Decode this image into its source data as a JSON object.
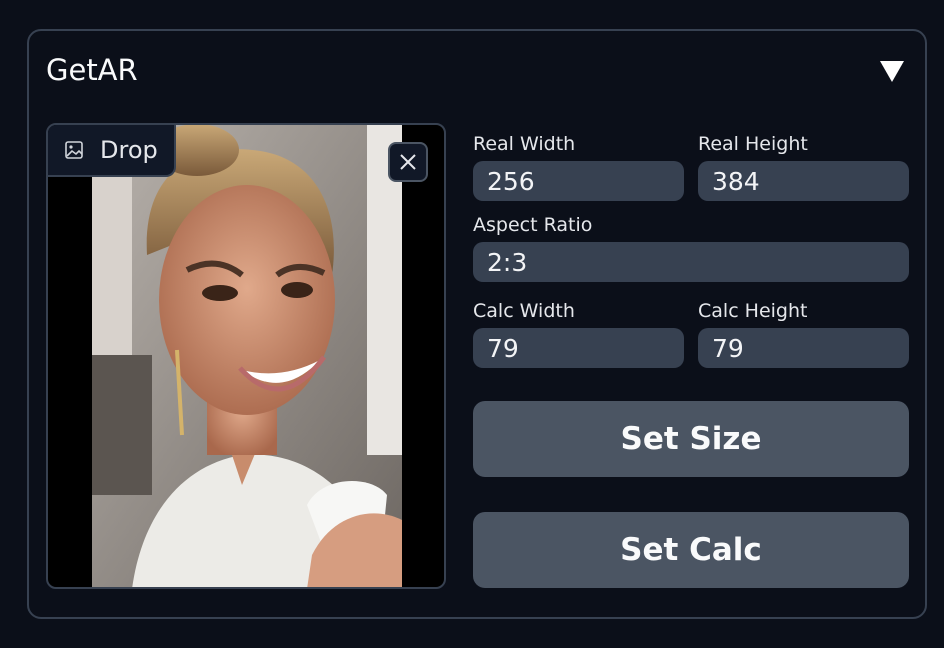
{
  "panel": {
    "title": "GetAR",
    "toggle_icon": "triangle-down-icon"
  },
  "image": {
    "drop_label": "Drop",
    "drop_icon": "image-icon",
    "close_icon": "close-icon",
    "alt": "Portrait photo"
  },
  "fields": {
    "real_width": {
      "label": "Real Width",
      "value": "256"
    },
    "real_height": {
      "label": "Real Height",
      "value": "384"
    },
    "aspect_ratio": {
      "label": "Aspect Ratio",
      "value": "2:3"
    },
    "calc_width": {
      "label": "Calc Width",
      "value": "79"
    },
    "calc_height": {
      "label": "Calc Height",
      "value": "79"
    }
  },
  "buttons": {
    "set_size": "Set Size",
    "set_calc": "Set Calc"
  },
  "colors": {
    "background": "#0b0f19",
    "field_bg": "#374151",
    "button_bg": "#4b5563",
    "border": "#374151"
  }
}
